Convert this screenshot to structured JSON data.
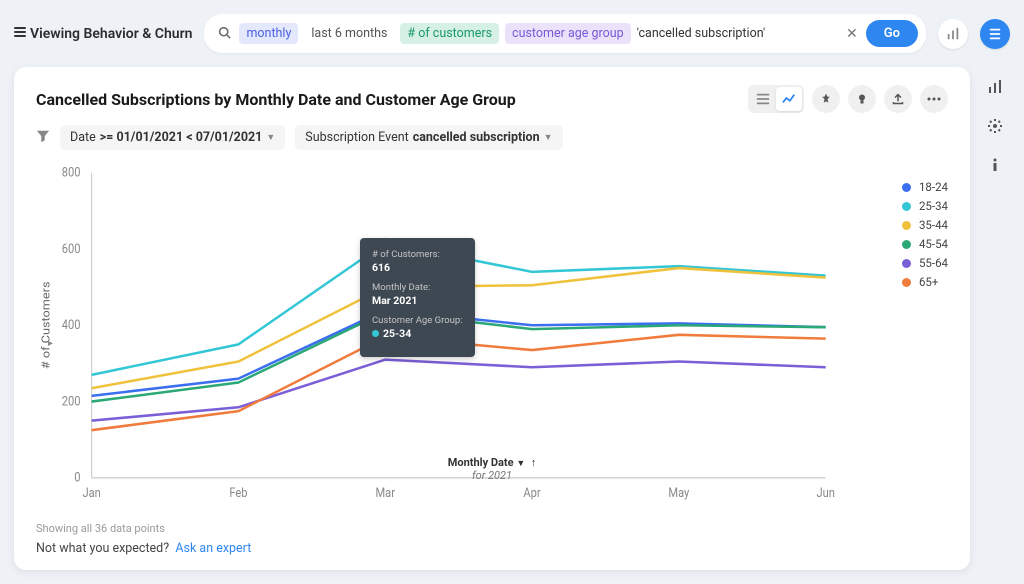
{
  "brand": "Viewing Behavior & Churn",
  "search": {
    "pill_monthly": "monthly",
    "pill_last6": "last 6 months",
    "pill_customers": "# of customers",
    "pill_agegroup": "customer age group",
    "query_text": "'cancelled subscription'",
    "go": "Go"
  },
  "card": {
    "title": "Cancelled Subscriptions by Monthly Date and Customer Age Group",
    "filter_date_label": "Date ",
    "filter_date_value": ">= 01/01/2021 < 07/01/2021",
    "filter_event_label": "Subscription Event ",
    "filter_event_value": "cancelled subscription",
    "y_title": "# of Customers",
    "x_title": "Monthly Date",
    "x_subtitle": "for 2021",
    "showing": "Showing all 36 data points",
    "footer_q": "Not what you expected?",
    "footer_link": "Ask an expert"
  },
  "tooltip": {
    "metric_label": "# of Customers:",
    "metric_value": "616",
    "date_label": "Monthly Date:",
    "date_value": "Mar 2021",
    "group_label": "Customer Age Group:",
    "group_value": "25-34",
    "color": "#33c7d5"
  },
  "legend": [
    {
      "label": "18-24",
      "color": "#3c6ff0"
    },
    {
      "label": "25-34",
      "color": "#33c7d5"
    },
    {
      "label": "35-44",
      "color": "#f0c23c"
    },
    {
      "label": "45-54",
      "color": "#2aa876"
    },
    {
      "label": "55-64",
      "color": "#7a5fd6"
    },
    {
      "label": "65+",
      "color": "#f07b3c"
    }
  ],
  "chart_data": {
    "type": "line",
    "x": [
      "Jan",
      "Feb",
      "Mar",
      "Apr",
      "May",
      "Jun"
    ],
    "xlabel": "Monthly Date",
    "ylabel": "# of Customers",
    "ylim": [
      0,
      800
    ],
    "title": "Cancelled Subscriptions by Monthly Date and Customer Age Group",
    "series": [
      {
        "name": "18-24",
        "color": "#3c6ff0",
        "values": [
          215,
          260,
          440,
          400,
          405,
          395
        ]
      },
      {
        "name": "25-34",
        "color": "#33c7d5",
        "values": [
          270,
          350,
          616,
          540,
          555,
          530
        ]
      },
      {
        "name": "35-44",
        "color": "#f0c23c",
        "values": [
          235,
          305,
          500,
          505,
          550,
          525
        ]
      },
      {
        "name": "45-54",
        "color": "#2aa876",
        "values": [
          200,
          250,
          435,
          390,
          400,
          395
        ]
      },
      {
        "name": "55-64",
        "color": "#7a5fd6",
        "values": [
          150,
          185,
          310,
          290,
          305,
          290
        ]
      },
      {
        "name": "65+",
        "color": "#f07b3c",
        "values": [
          125,
          175,
          370,
          335,
          375,
          365
        ]
      }
    ]
  }
}
